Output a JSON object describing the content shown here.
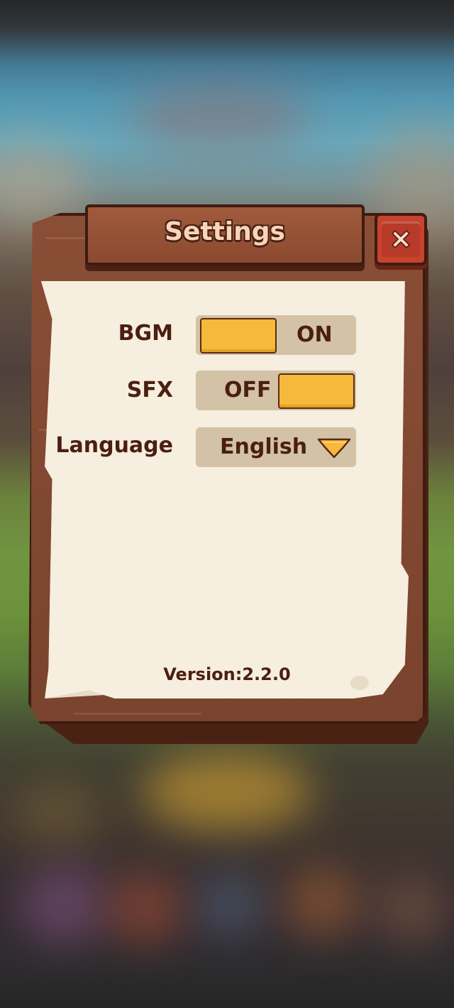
{
  "dialog": {
    "title": "Settings",
    "close_icon": "close-x-icon"
  },
  "settings": {
    "bgm": {
      "label": "BGM",
      "state_text": "ON",
      "enabled": true
    },
    "sfx": {
      "label": "SFX",
      "state_text": "OFF",
      "enabled": false
    },
    "language": {
      "label": "Language",
      "value": "English",
      "icon": "chevron-down-icon"
    }
  },
  "footer": {
    "version": "Version:2.2.0"
  },
  "colors": {
    "wood": "#8a4e36",
    "wood_dark": "#3d1c10",
    "paper": "#f6eede",
    "toggle_track": "#d3c2a6",
    "toggle_knob": "#f5b93b",
    "close_button": "#c8432e",
    "text": "#4a1f12",
    "title_text": "#f7d5b8"
  }
}
